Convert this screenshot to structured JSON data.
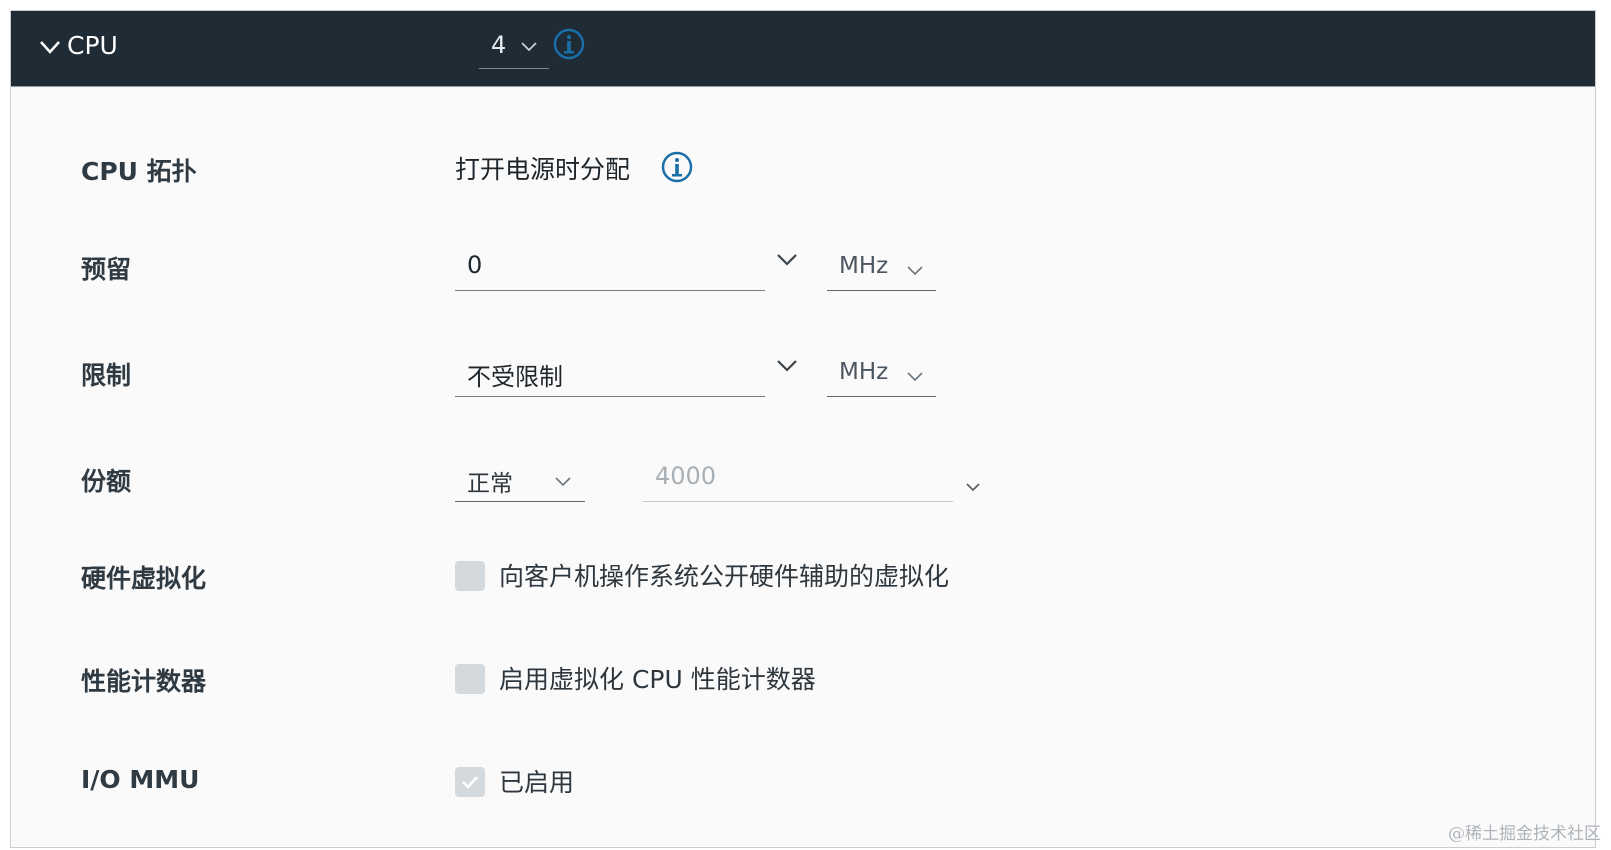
{
  "header": {
    "title": "CPU",
    "cpu_count": "4",
    "chevron_icon": "chevron-down-icon",
    "info_icon": "info-icon"
  },
  "rows": {
    "topology": {
      "label": "CPU 拓扑",
      "value": "打开电源时分配"
    },
    "reservation": {
      "label": "预留",
      "value": "0",
      "unit": "MHz"
    },
    "limit": {
      "label": "限制",
      "value": "不受限制",
      "unit": "MHz"
    },
    "shares": {
      "label": "份额",
      "level": "正常",
      "value": "4000"
    },
    "hw_virtualization": {
      "label": "硬件虚拟化",
      "checkbox_label": "向客户机操作系统公开硬件辅助的虚拟化",
      "checked": false
    },
    "perf_counters": {
      "label": "性能计数器",
      "checkbox_label": "启用虚拟化 CPU 性能计数器",
      "checked": false
    },
    "iommu": {
      "label": "I/O MMU",
      "checkbox_label": "已启用",
      "checked": true
    }
  },
  "colors": {
    "header_bg": "#1f2b35",
    "info_blue": "#1a6fa8",
    "checkbox_bg": "#d4d9dd"
  },
  "watermark": "@稀土掘金技术社区"
}
